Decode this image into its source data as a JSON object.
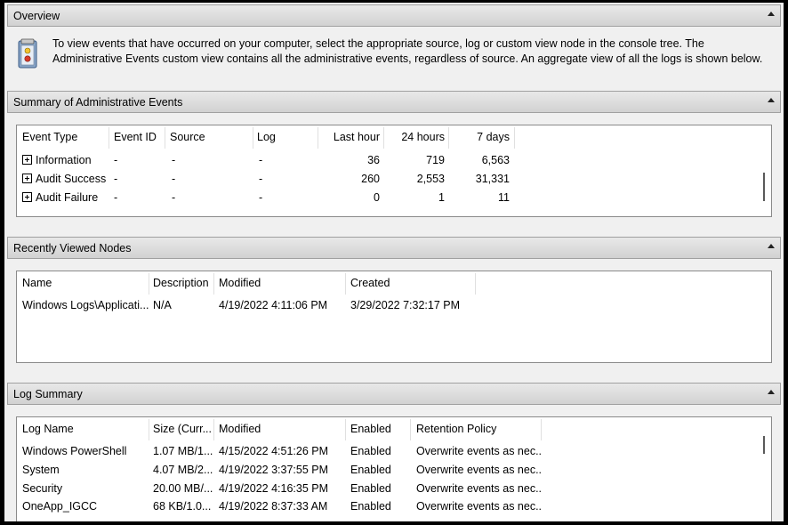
{
  "overview": {
    "title": "Overview",
    "text": "To view events that have occurred on your computer, select the appropriate source, log or custom view node in the console tree. The Administrative Events custom view contains all the administrative events, regardless of source. An aggregate view of all the logs is shown below.",
    "icon": "event-viewer-icon"
  },
  "summary": {
    "title": "Summary of Administrative Events",
    "columns": [
      "Event Type",
      "Event ID",
      "Source",
      "Log",
      "Last hour",
      "24 hours",
      "7 days"
    ],
    "rows": [
      {
        "type": "Information",
        "event_id": "-",
        "source": "-",
        "log": "-",
        "last_hour": "36",
        "h24": "719",
        "d7": "6,563"
      },
      {
        "type": "Audit Success",
        "event_id": "-",
        "source": "-",
        "log": "-",
        "last_hour": "260",
        "h24": "2,553",
        "d7": "31,331"
      },
      {
        "type": "Audit Failure",
        "event_id": "-",
        "source": "-",
        "log": "-",
        "last_hour": "0",
        "h24": "1",
        "d7": "11"
      }
    ]
  },
  "recent": {
    "title": "Recently Viewed Nodes",
    "columns": [
      "Name",
      "Description",
      "Modified",
      "Created"
    ],
    "rows": [
      {
        "name": "Windows Logs\\Applicati...",
        "description": "N/A",
        "modified": "4/19/2022 4:11:06 PM",
        "created": "3/29/2022 7:32:17 PM"
      }
    ]
  },
  "log_summary": {
    "title": "Log Summary",
    "columns": [
      "Log Name",
      "Size (Curr...",
      "Modified",
      "Enabled",
      "Retention Policy"
    ],
    "rows": [
      {
        "name": "Windows PowerShell",
        "size": "1.07 MB/1...",
        "modified": "4/15/2022 4:51:26 PM",
        "enabled": "Enabled",
        "retention": "Overwrite events as nec..."
      },
      {
        "name": "System",
        "size": "4.07 MB/2...",
        "modified": "4/19/2022 3:37:55 PM",
        "enabled": "Enabled",
        "retention": "Overwrite events as nec..."
      },
      {
        "name": "Security",
        "size": "20.00 MB/...",
        "modified": "4/19/2022 4:16:35 PM",
        "enabled": "Enabled",
        "retention": "Overwrite events as nec..."
      },
      {
        "name": "OneApp_IGCC",
        "size": "68 KB/1.0...",
        "modified": "4/19/2022 8:37:33 AM",
        "enabled": "Enabled",
        "retention": "Overwrite events as nec..."
      }
    ]
  }
}
